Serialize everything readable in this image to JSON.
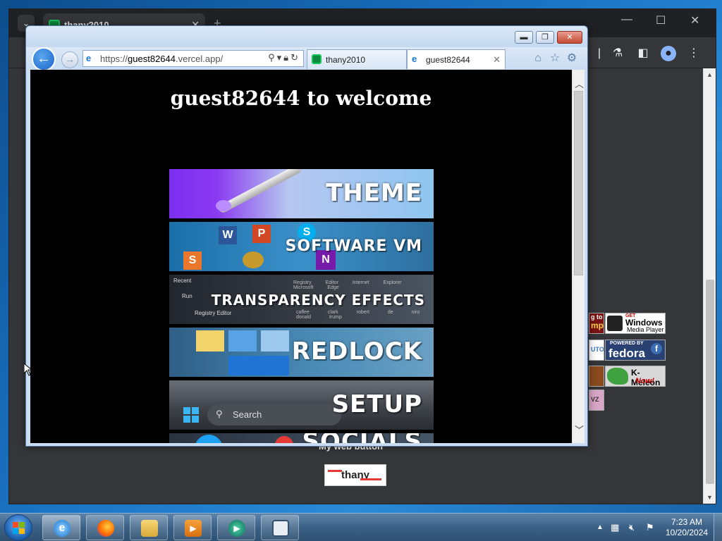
{
  "chrome": {
    "tab_title": "thany2010",
    "tab_close": "✕",
    "new_tab": "+",
    "minimize": "—",
    "maximize": "☐",
    "close": "✕"
  },
  "chrome_page": {
    "badges": [
      {
        "text": "Windows",
        "sub": "Media Player",
        "top": "GET"
      },
      {
        "text": "fedora",
        "top": "POWERED BY"
      },
      {
        "text": "K-Meleon",
        "sub": "Now!"
      }
    ],
    "partial_badges": [
      "g to",
      "mp",
      "UTO",
      "VZ"
    ],
    "my_web_button_label": "My web button",
    "thany_button_text": "thany"
  },
  "ie": {
    "address": {
      "scheme": "https://",
      "domain": "guest82644",
      "rest": ".vercel.app/"
    },
    "tabs": [
      {
        "title": "thany2010",
        "active": false
      },
      {
        "title": "guest82644",
        "active": true
      }
    ],
    "tab_close": "✕",
    "page": {
      "heading": "guest82644 to welcome",
      "banners": [
        {
          "label": "THEME"
        },
        {
          "label": "SOFTWARE VM"
        },
        {
          "label": "TRANSPARENCY EFFECTS"
        },
        {
          "label": "REDLOCK"
        },
        {
          "label": "SETUP"
        },
        {
          "label": "SOCIALS"
        }
      ],
      "transparency_banner_text": {
        "recent": "Recent",
        "run": "Run",
        "registry_editor": "Registry Editor",
        "col_labels": [
          "Registry Editor",
          "Internet Explorer",
          "Microsoft Edge"
        ],
        "col_labels2": [
          "caffee clark",
          "robert de niro",
          "donald trump"
        ]
      },
      "setup_banner_search": "Search"
    }
  },
  "taskbar": {
    "time": "7:23 AM",
    "date": "10/20/2024"
  },
  "colors": {
    "ie_chrome": "#c9dcf1",
    "page_bg": "#000000",
    "chrome_dark": "#35363a",
    "taskbar": "#3c6186"
  }
}
